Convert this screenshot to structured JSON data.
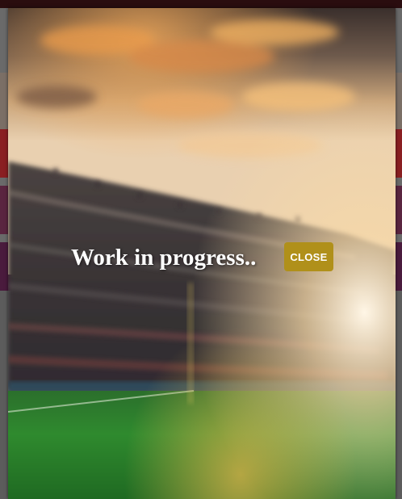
{
  "modal": {
    "title": "Work in progress..",
    "close_label": "CLOSE"
  },
  "colors": {
    "close_button": "#b0901a",
    "title_text": "#ffffff",
    "sky_top": "#2b2320",
    "sky_glow": "#f2c37a",
    "field_green": "#2e8a2a"
  },
  "background_image": "stadium-sunset-image"
}
